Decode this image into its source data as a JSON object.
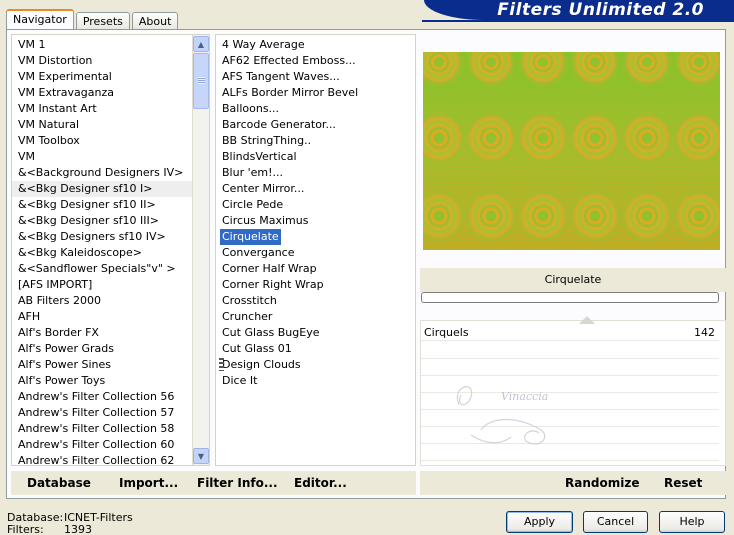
{
  "tabs": [
    {
      "label": "Navigator",
      "active": true
    },
    {
      "label": "Presets",
      "active": false
    },
    {
      "label": "About",
      "active": false
    }
  ],
  "banner_title": "Filters Unlimited 2.0",
  "categories": [
    "VM 1",
    "VM Distortion",
    "VM Experimental",
    "VM Extravaganza",
    "VM Instant Art",
    "VM Natural",
    "VM Toolbox",
    "VM",
    "&<Background Designers IV>",
    "&<Bkg Designer sf10 I>",
    "&<Bkg Designer sf10 II>",
    "&<Bkg Designer sf10 III>",
    "&<Bkg Designers sf10 IV>",
    "&<Bkg Kaleidoscope>",
    "&<Sandflower Specials\"v\" >",
    "[AFS IMPORT]",
    "AB Filters 2000",
    "AFH",
    "Alf's Border FX",
    "Alf's Power Grads",
    "Alf's Power Sines",
    "Alf's Power Toys",
    "Andrew's Filter Collection 56",
    "Andrew's Filter Collection 57",
    "Andrew's Filter Collection 58",
    "Andrew's Filter Collection 60",
    "Andrew's Filter Collection 62"
  ],
  "categories_highlight_index": 9,
  "filters": [
    "4 Way Average",
    "AF62 Effected Emboss...",
    "AFS Tangent Waves...",
    "ALFs Border Mirror Bevel",
    "Balloons...",
    "Barcode Generator...",
    "BB StringThing..",
    "BlindsVertical",
    "Blur 'em!...",
    "Center Mirror...",
    "Circle Pede",
    "Circus Maximus",
    "Cirquelate",
    "Convergance",
    "Corner Half Wrap",
    "Corner Right Wrap",
    "Crosstitch",
    "Cruncher",
    "Cut Glass  BugEye",
    "Cut Glass 01",
    "Design Clouds",
    "Dice It"
  ],
  "filters_selected_index": 12,
  "bottom_left_buttons": {
    "database": "Database",
    "import": "Import...",
    "filter_info": "Filter Info...",
    "editor": "Editor..."
  },
  "bottom_right_buttons": {
    "randomize": "Randomize",
    "reset": "Reset"
  },
  "selected_filter_name": "Cirquelate",
  "parameter": {
    "name": "Cirquels",
    "value": "142"
  },
  "footer": {
    "database_label": "Database:",
    "database_value": "ICNET-Filters",
    "filters_label": "Filters:",
    "filters_value": "1393"
  },
  "dialog_buttons": {
    "apply": "Apply",
    "cancel": "Cancel",
    "help": "Help"
  },
  "colors": {
    "preview_green": "#8fc12c",
    "preview_orange": "#f0a020",
    "selection": "#316ac5",
    "banner": "#0a2c8c"
  },
  "watermark_text": "Vinaccia"
}
